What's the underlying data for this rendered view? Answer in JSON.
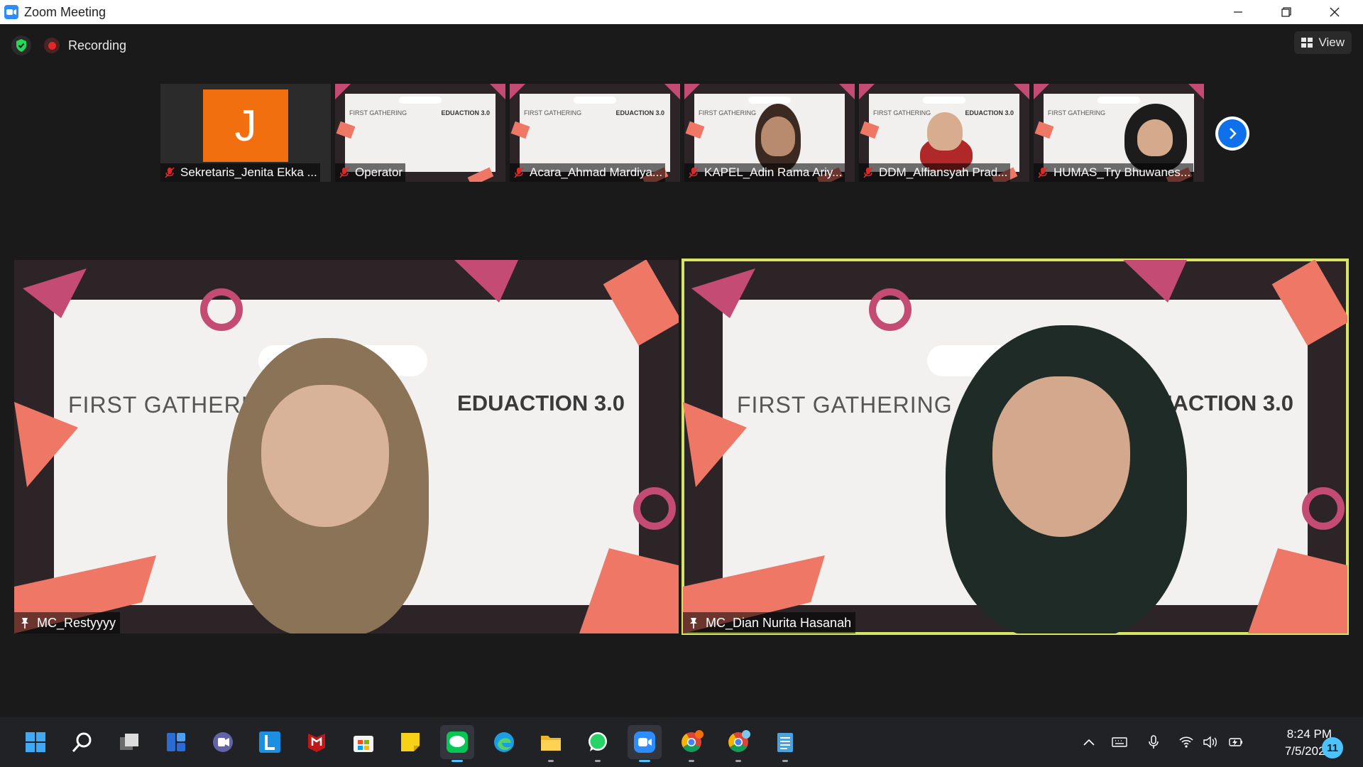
{
  "window": {
    "title": "Zoom Meeting"
  },
  "meeting": {
    "recording_label": "Recording",
    "view_label": "View"
  },
  "thumbnails": [
    {
      "name": "Sekretaris_Jenita Ekka ...",
      "avatar_letter": "J",
      "avatar_color": "#f26f10"
    },
    {
      "name": "Operator"
    },
    {
      "name": "Acara_Ahmad Mardiya..."
    },
    {
      "name": "KAPEL_Adin Rama Ariy..."
    },
    {
      "name": "DDM_Alfiansyah Prad..."
    },
    {
      "name": "HUMAS_Try Bhuwanes..."
    }
  ],
  "slide": {
    "left_text": "FIRST GATHERING",
    "left_text_cut": "FIRST GATHERI",
    "right_text": "EDUACTION 3.0",
    "thumb_left_text": "FIRST GATHERING",
    "thumb_right_text": "EDUACTION 3.0"
  },
  "main_tiles": [
    {
      "name": "MC_Restyyyy",
      "active": false
    },
    {
      "name": "MC_Dian Nurita Hasanah",
      "active": true,
      "highlight_color": "#d6e660"
    }
  ],
  "taskbar": {
    "apps": [
      "start-icon",
      "search-icon",
      "task-view-icon",
      "widgets-icon",
      "teams-chat-icon",
      "l-app-icon",
      "mcafee-icon",
      "store-icon",
      "sticky-notes-icon",
      "line-icon",
      "edge-icon",
      "file-explorer-icon",
      "whatsapp-icon",
      "zoom-icon",
      "chrome-icon",
      "chrome-profile-icon",
      "notepad-icon"
    ],
    "time": "8:24 PM",
    "date": "7/5/2022",
    "notification_count": "11"
  }
}
